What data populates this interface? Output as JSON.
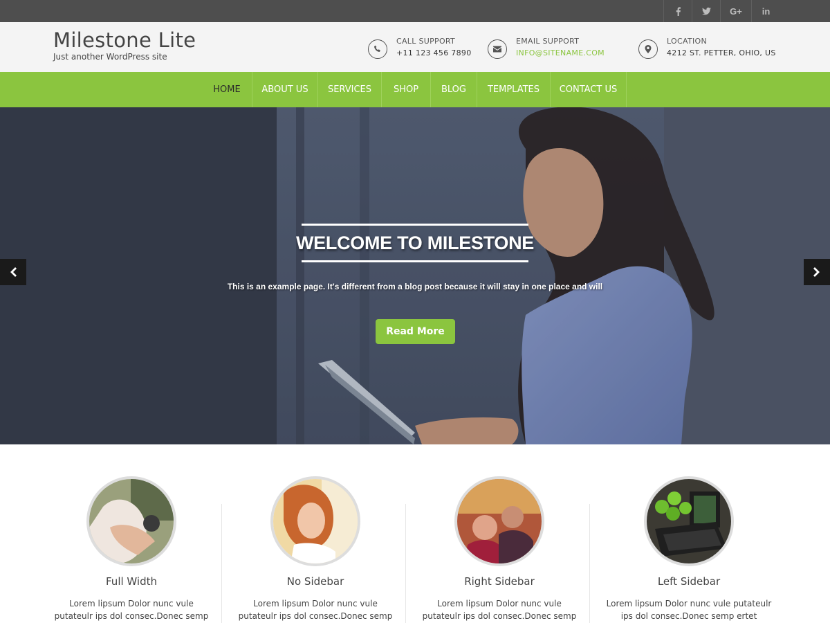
{
  "topbar": {
    "social": [
      {
        "name": "facebook-icon",
        "glyph": "f"
      },
      {
        "name": "twitter-icon",
        "glyph": "t"
      },
      {
        "name": "google-plus-icon",
        "glyph": "G+"
      },
      {
        "name": "linkedin-icon",
        "glyph": "in"
      }
    ]
  },
  "header": {
    "title": "Milestone Lite",
    "tagline": "Just another WordPress site",
    "call": {
      "label": "CALL SUPPORT",
      "value": "+11 123 456 7890"
    },
    "email": {
      "label": "EMAIL SUPPORT",
      "value": "INFO@SITENAME.COM"
    },
    "location": {
      "label": "LOCATION",
      "value": "4212 ST. PETTER, OHIO, US"
    }
  },
  "nav": {
    "items": [
      "HOME",
      "ABOUT US",
      "SERVICES",
      "SHOP",
      "BLOG",
      "TEMPLATES",
      "CONTACT US"
    ],
    "active": "HOME"
  },
  "hero": {
    "title": "WELCOME TO MILESTONE",
    "text": "This is an example page. It's different from a blog post because it will stay in one place and will",
    "button": "Read More"
  },
  "features": [
    {
      "title": "Full Width",
      "line1": "Lorem lipsum Dolor nunc vule",
      "line2": "putateulr ips dol consec.Donec semp"
    },
    {
      "title": "No Sidebar",
      "line1": "Lorem lipsum Dolor nunc vule",
      "line2": "putateulr ips dol consec.Donec semp"
    },
    {
      "title": "Right Sidebar",
      "line1": "Lorem lipsum Dolor nunc vule",
      "line2": "putateulr ips dol consec.Donec semp"
    },
    {
      "title": "Left Sidebar",
      "line1": "Lorem lipsum Dolor nunc vule putateulr",
      "line2": "ips dol consec.Donec semp ertet"
    }
  ],
  "colors": {
    "accent": "#8bc53f",
    "topbar": "#4e4e4e",
    "header_bg": "#f4f4f4"
  }
}
